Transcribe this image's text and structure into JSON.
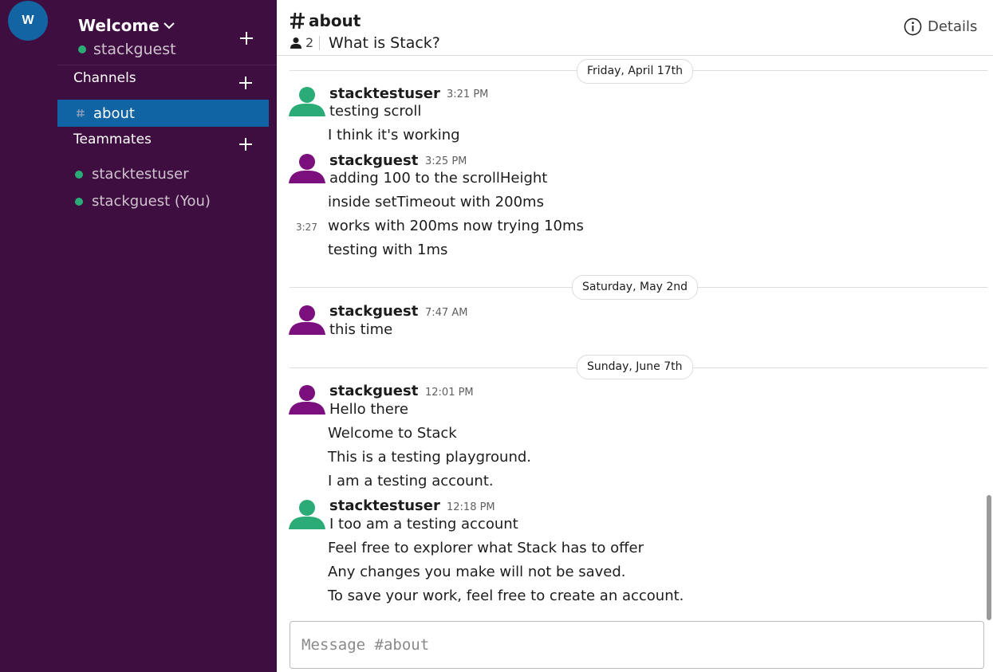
{
  "workspace": {
    "initial": "W"
  },
  "sidebar": {
    "team_name": "Welcome",
    "current_user": "stackguest",
    "channels_label": "Channels",
    "channels": [
      {
        "name": "about",
        "active": true
      }
    ],
    "teammates_label": "Teammates",
    "teammates": [
      {
        "name": "stacktestuser",
        "online": true
      },
      {
        "name": "stackguest (You)",
        "online": true
      }
    ]
  },
  "header": {
    "channel_name": "about",
    "member_count": "2",
    "topic": "What is Stack?",
    "details_label": "Details"
  },
  "messages": {
    "days": [
      {
        "label": "Friday, April 17th",
        "groups": [
          {
            "author": "stacktestuser",
            "time": "3:21 PM",
            "avatar_color": "#2bac76",
            "lines": [
              "testing scroll",
              "I think it's working"
            ]
          },
          {
            "author": "stackguest",
            "time": "3:25 PM",
            "avatar_color": "#7b0f7d",
            "lines": [
              "adding 100 to the scrollHeight",
              "inside setTimeout with 200ms",
              "works with 200ms now trying 10ms",
              "testing with 1ms"
            ],
            "hover_time": "3:27"
          }
        ]
      },
      {
        "label": "Saturday, May 2nd",
        "groups": [
          {
            "author": "stackguest",
            "time": "7:47 AM",
            "avatar_color": "#7b0f7d",
            "lines": [
              "this time"
            ]
          }
        ]
      },
      {
        "label": "Sunday, June 7th",
        "groups": [
          {
            "author": "stackguest",
            "time": "12:01 PM",
            "avatar_color": "#7b0f7d",
            "lines": [
              "Hello there",
              "Welcome to Stack",
              "This is a testing playground.",
              "I am a testing account."
            ]
          },
          {
            "author": "stacktestuser",
            "time": "12:18 PM",
            "avatar_color": "#2bac76",
            "lines": [
              "I too am a testing account",
              "Feel free to explorer what Stack has to offer",
              "Any changes you make will not be saved.",
              "To save your work, feel free to create an account."
            ]
          }
        ]
      }
    ]
  },
  "composer": {
    "placeholder": "Message #about"
  },
  "colors": {
    "sidebar_bg": "#3f0e40",
    "active_channel": "#1164a3",
    "online": "#2bac76",
    "workspace_button": "#1264a3"
  }
}
